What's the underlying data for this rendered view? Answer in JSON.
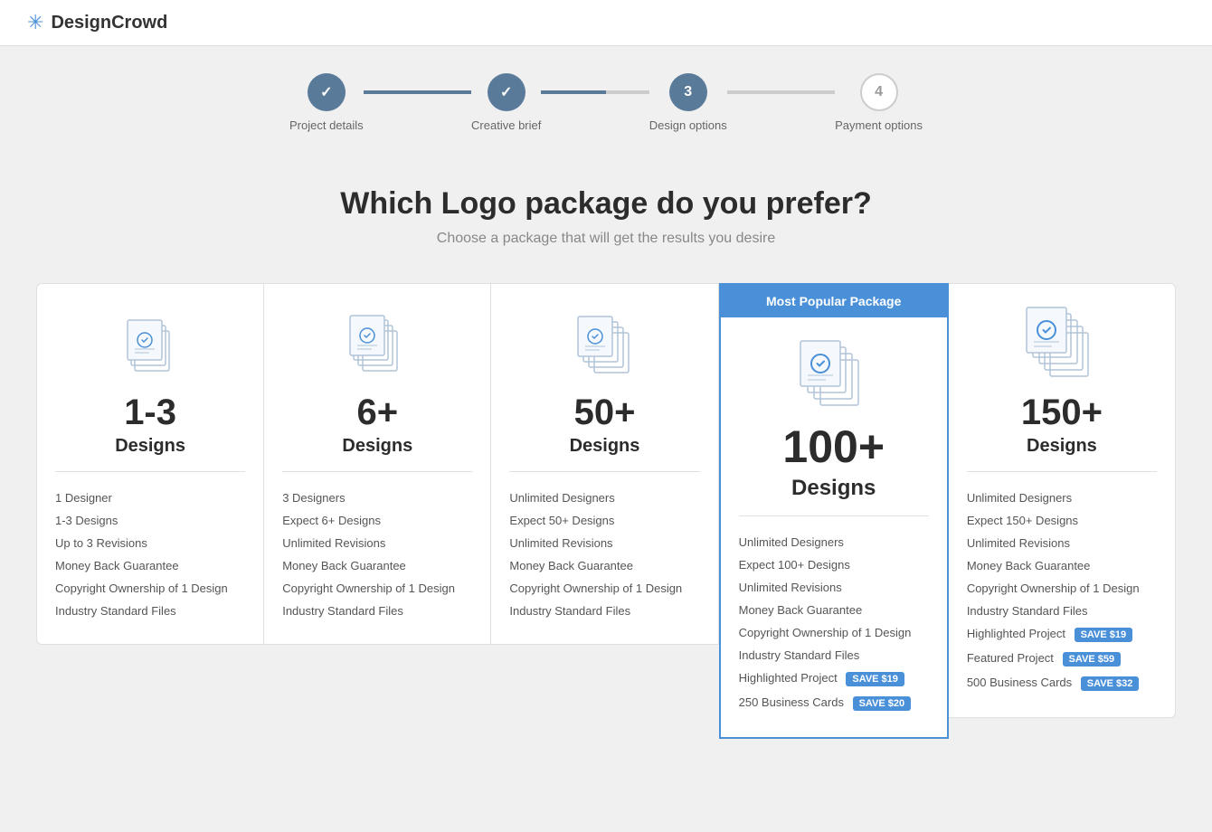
{
  "header": {
    "logo_icon": "✳",
    "logo_text": "DesignCrowd"
  },
  "steps": [
    {
      "id": 1,
      "label": "Project details",
      "state": "completed",
      "display": "✓"
    },
    {
      "id": 2,
      "label": "Creative brief",
      "state": "completed",
      "display": "✓"
    },
    {
      "id": 3,
      "label": "Design options",
      "state": "active",
      "display": "3"
    },
    {
      "id": 4,
      "label": "Payment options",
      "state": "inactive",
      "display": "4"
    }
  ],
  "connectors": [
    "filled",
    "half",
    "empty"
  ],
  "page": {
    "title": "Which Logo package do you prefer?",
    "subtitle": "Choose a package that will get the results you desire"
  },
  "packages": [
    {
      "id": "basic",
      "count": "1-3",
      "label": "Designs",
      "popular": false,
      "features": [
        "1 Designer",
        "1-3 Designs",
        "Up to 3 Revisions",
        "Money Back Guarantee",
        "Copyright Ownership of 1 Design",
        "Industry Standard Files"
      ],
      "extras": []
    },
    {
      "id": "starter",
      "count": "6+",
      "label": "Designs",
      "popular": false,
      "features": [
        "3 Designers",
        "Expect 6+ Designs",
        "Unlimited Revisions",
        "Money Back Guarantee",
        "Copyright Ownership of 1 Design",
        "Industry Standard Files"
      ],
      "extras": []
    },
    {
      "id": "standard",
      "count": "50+",
      "label": "Designs",
      "popular": false,
      "features": [
        "Unlimited Designers",
        "Expect 50+ Designs",
        "Unlimited Revisions",
        "Money Back Guarantee",
        "Copyright Ownership of 1 Design",
        "Industry Standard Files"
      ],
      "extras": []
    },
    {
      "id": "popular",
      "count": "100+",
      "label": "Designs",
      "popular": true,
      "popular_label": "Most Popular Package",
      "features": [
        "Unlimited Designers",
        "Expect 100+ Designs",
        "Unlimited Revisions",
        "Money Back Guarantee",
        "Copyright Ownership of 1 Design",
        "Industry Standard Files"
      ],
      "extras": [
        {
          "text": "Highlighted Project",
          "save": "SAVE $19"
        },
        {
          "text": "250 Business Cards",
          "save": "SAVE $20"
        }
      ]
    },
    {
      "id": "premium",
      "count": "150+",
      "label": "Designs",
      "popular": false,
      "features": [
        "Unlimited Designers",
        "Expect 150+ Designs",
        "Unlimited Revisions",
        "Money Back Guarantee",
        "Copyright Ownership of 1 Design",
        "Industry Standard Files"
      ],
      "extras": [
        {
          "text": "Highlighted Project",
          "save": "SAVE $19"
        },
        {
          "text": "Featured Project",
          "save": "SAVE $59"
        },
        {
          "text": "500 Business Cards",
          "save": "SAVE $32"
        }
      ]
    }
  ]
}
